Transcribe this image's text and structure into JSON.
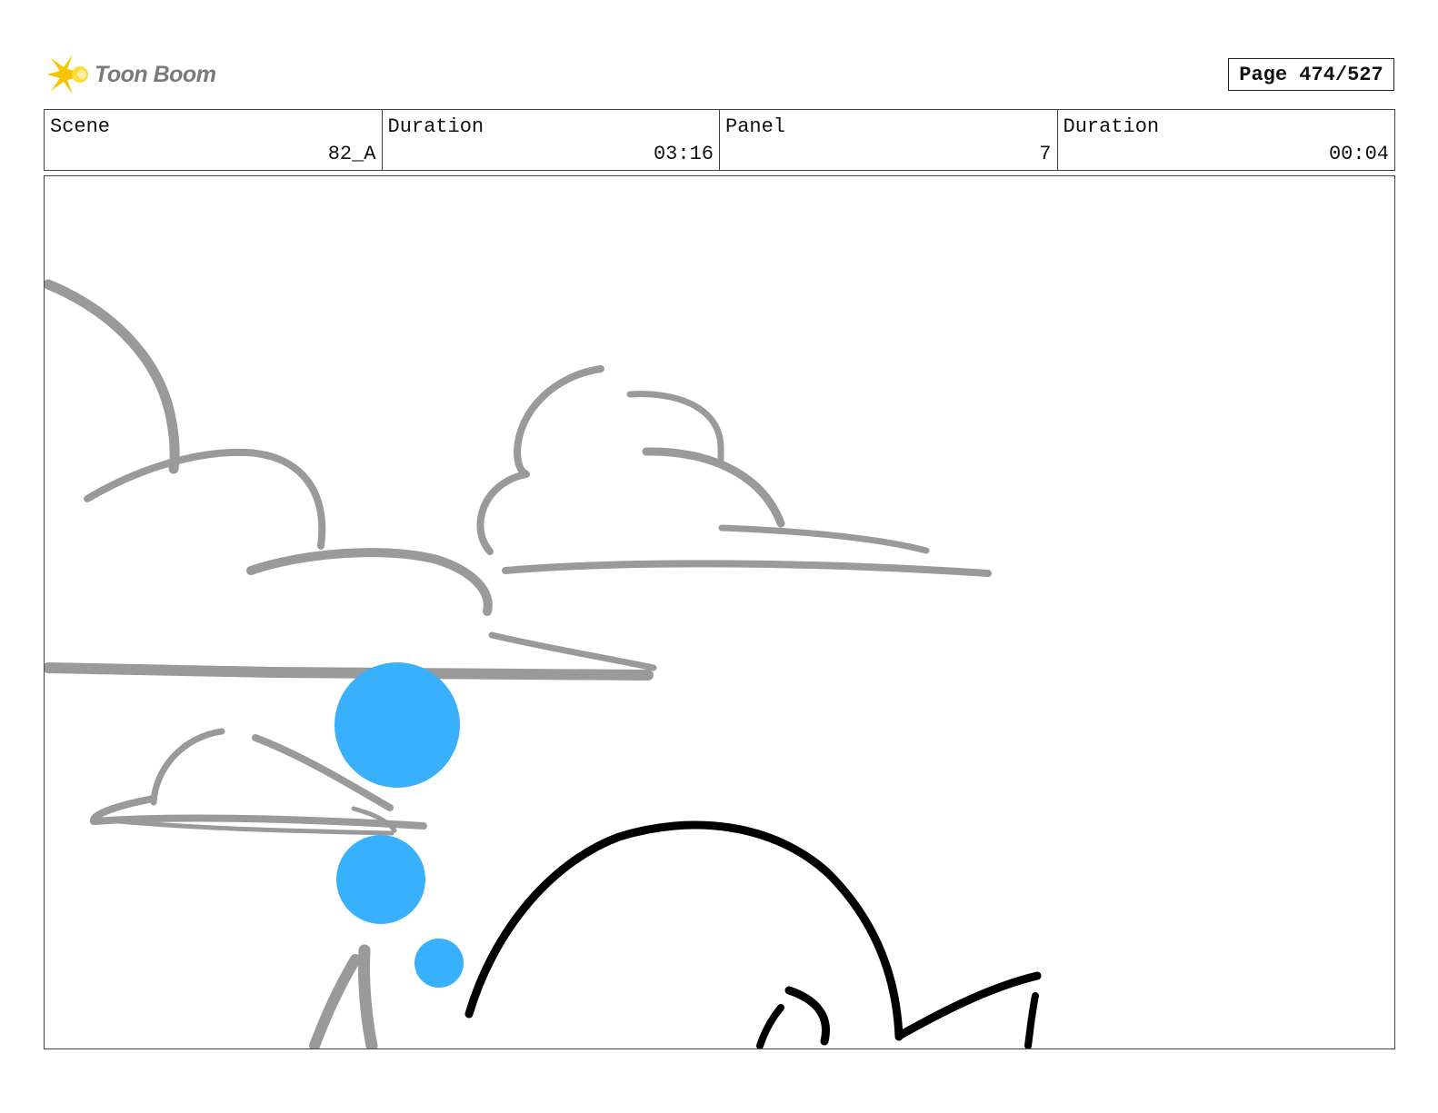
{
  "header": {
    "logo_text": "Toon Boom",
    "page_label": "Page 474/527"
  },
  "info_bar": {
    "cells": [
      {
        "label": "Scene",
        "value": "82_A"
      },
      {
        "label": "Duration",
        "value": "03:16"
      },
      {
        "label": "Panel",
        "value": "7"
      },
      {
        "label": "Duration",
        "value": "00:04"
      }
    ]
  },
  "colors": {
    "cloud_stroke": "#9a9a9a",
    "bubble_fill": "#38b0fb",
    "character_stroke": "#000000",
    "logo_star": "#f7c600"
  }
}
